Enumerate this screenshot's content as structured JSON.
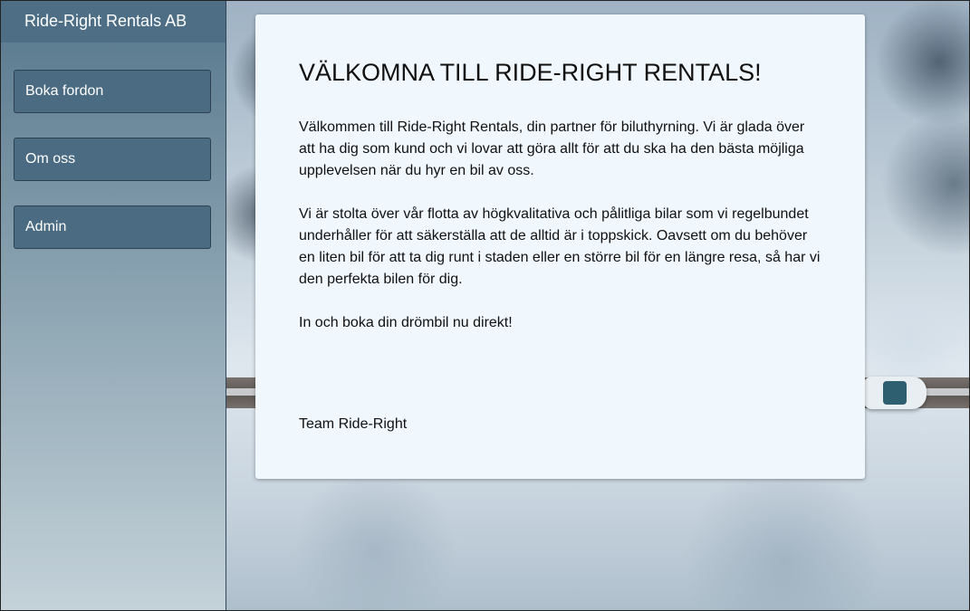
{
  "sidebar": {
    "brand": "Ride-Right Rentals AB",
    "items": [
      {
        "label": "Boka fordon"
      },
      {
        "label": "Om oss"
      },
      {
        "label": "Admin"
      }
    ]
  },
  "main": {
    "title": "VÄLKOMNA TILL RIDE-RIGHT RENTALS!",
    "paragraphs": [
      "Välkommen till Ride-Right Rentals, din partner för biluthyrning. Vi är glada över att ha dig som kund och vi lovar att göra allt för att du ska ha den bästa möjliga upplevelsen när du hyr en bil av oss.",
      "Vi är stolta över vår flotta av högkvalitativa och pålitliga bilar som vi regelbundet underhåller för att säkerställa att de alltid är i toppskick. Oavsett om du behöver en liten bil för att ta dig runt i staden eller en större bil för en längre resa, så har vi den perfekta bilen för dig.",
      "In och boka din drömbil nu direkt!"
    ],
    "signature": "Team Ride-Right"
  },
  "colors": {
    "sidebar_header": "#4d6e85",
    "nav_button": "#4b6b82",
    "card_background": "#f0f7fd"
  }
}
